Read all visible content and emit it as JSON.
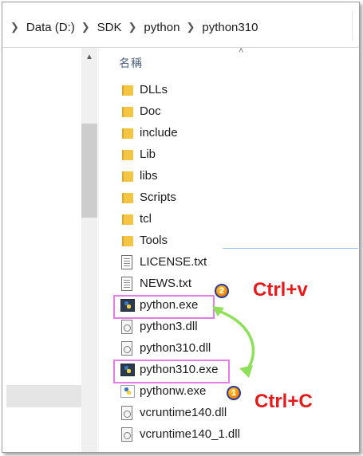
{
  "breadcrumb": [
    "Data (D:)",
    "SDK",
    "python",
    "python310"
  ],
  "column_header": "名稱",
  "files": [
    {
      "name": "DLLs",
      "type": "folder"
    },
    {
      "name": "Doc",
      "type": "folder"
    },
    {
      "name": "include",
      "type": "folder"
    },
    {
      "name": "Lib",
      "type": "folder"
    },
    {
      "name": "libs",
      "type": "folder"
    },
    {
      "name": "Scripts",
      "type": "folder"
    },
    {
      "name": "tcl",
      "type": "folder"
    },
    {
      "name": "Tools",
      "type": "folder"
    },
    {
      "name": "LICENSE.txt",
      "type": "text"
    },
    {
      "name": "NEWS.txt",
      "type": "text"
    },
    {
      "name": "python.exe",
      "type": "exe"
    },
    {
      "name": "python3.dll",
      "type": "dll"
    },
    {
      "name": "python310.dll",
      "type": "dll"
    },
    {
      "name": "python310.exe",
      "type": "exe"
    },
    {
      "name": "pythonw.exe",
      "type": "pyw"
    },
    {
      "name": "vcruntime140.dll",
      "type": "dll"
    },
    {
      "name": "vcruntime140_1.dll",
      "type": "dll"
    }
  ],
  "annotations": {
    "step2_number": "2",
    "step2_label": "Ctrl+v",
    "step1_number": "1",
    "step1_label": "Ctrl+C"
  },
  "colors": {
    "highlight": "#e47ee6",
    "arrow": "#8ee05a",
    "annotation_text": "#e41b1b",
    "folder": "#f4c542"
  }
}
